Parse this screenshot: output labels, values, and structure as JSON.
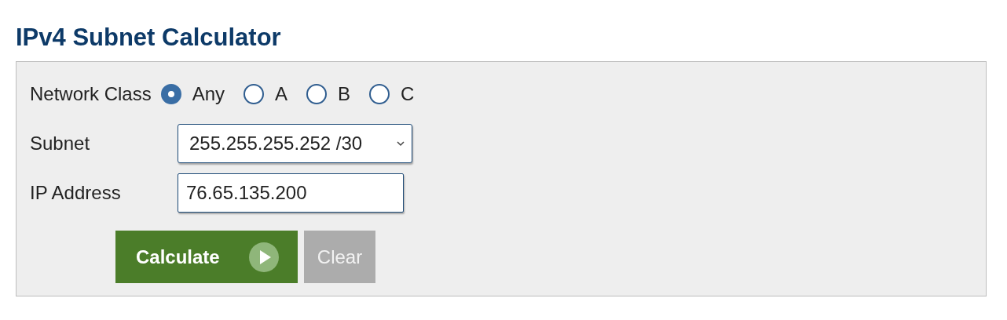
{
  "title": "IPv4 Subnet Calculator",
  "form": {
    "network_class": {
      "label": "Network Class",
      "options": [
        {
          "label": "Any",
          "selected": true
        },
        {
          "label": "A",
          "selected": false
        },
        {
          "label": "B",
          "selected": false
        },
        {
          "label": "C",
          "selected": false
        }
      ]
    },
    "subnet": {
      "label": "Subnet",
      "value": "255.255.255.252 /30"
    },
    "ip_address": {
      "label": "IP Address",
      "value": "76.65.135.200"
    },
    "buttons": [
      {
        "label": "Calculate",
        "kind": "primary"
      },
      {
        "label": "Clear",
        "kind": "secondary"
      }
    ]
  }
}
